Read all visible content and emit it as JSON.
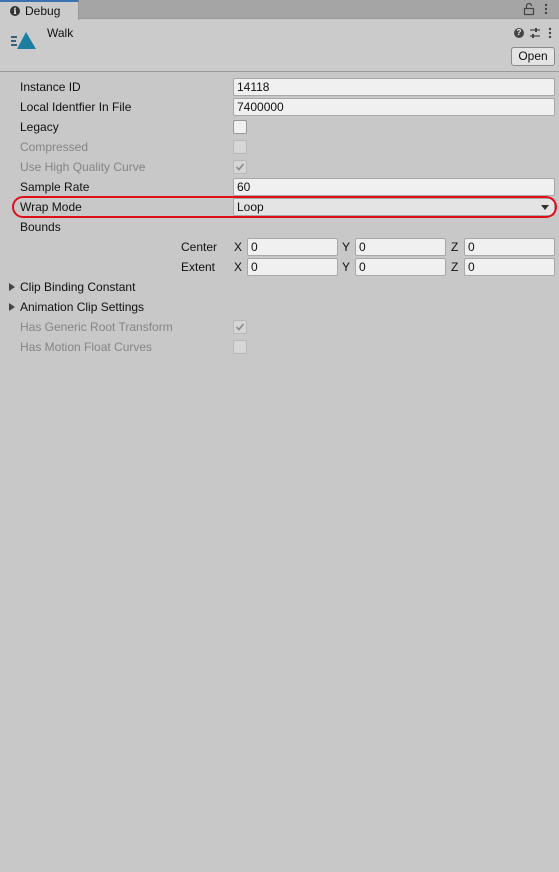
{
  "tab": {
    "title": "Debug"
  },
  "header": {
    "asset_name": "Walk",
    "open_button": "Open"
  },
  "fields": {
    "instance_id": {
      "label": "Instance ID",
      "value": "14118"
    },
    "local_identifier": {
      "label": "Local Identfier In File",
      "value": "7400000"
    },
    "legacy": {
      "label": "Legacy",
      "checked": false
    },
    "compressed": {
      "label": "Compressed",
      "checked": false
    },
    "use_high_quality_curve": {
      "label": "Use High Quality Curve",
      "checked": true
    },
    "sample_rate": {
      "label": "Sample Rate",
      "value": "60"
    },
    "wrap_mode": {
      "label": "Wrap Mode",
      "value": "Loop"
    },
    "bounds": {
      "label": "Bounds",
      "center": {
        "label": "Center",
        "x": "0",
        "y": "0",
        "z": "0"
      },
      "extent": {
        "label": "Extent",
        "x": "0",
        "y": "0",
        "z": "0"
      },
      "axis_x": "X",
      "axis_y": "Y",
      "axis_z": "Z"
    },
    "clip_binding_constant": {
      "label": "Clip Binding Constant"
    },
    "animation_clip_settings": {
      "label": "Animation Clip Settings"
    },
    "has_generic_root_transform": {
      "label": "Has Generic Root Transform",
      "checked": true
    },
    "has_motion_float_curves": {
      "label": "Has Motion Float Curves",
      "checked": false
    }
  },
  "colors": {
    "highlight": "#e0101a",
    "accent": "#3a72b0",
    "clip_icon": "#1a7fa0"
  },
  "icons": [
    "info-icon",
    "lock-icon",
    "menu-icon",
    "animation-clip-icon",
    "help-icon",
    "preset-icon",
    "check-icon",
    "dropdown-arrow-icon",
    "foldout-arrow-icon"
  ]
}
